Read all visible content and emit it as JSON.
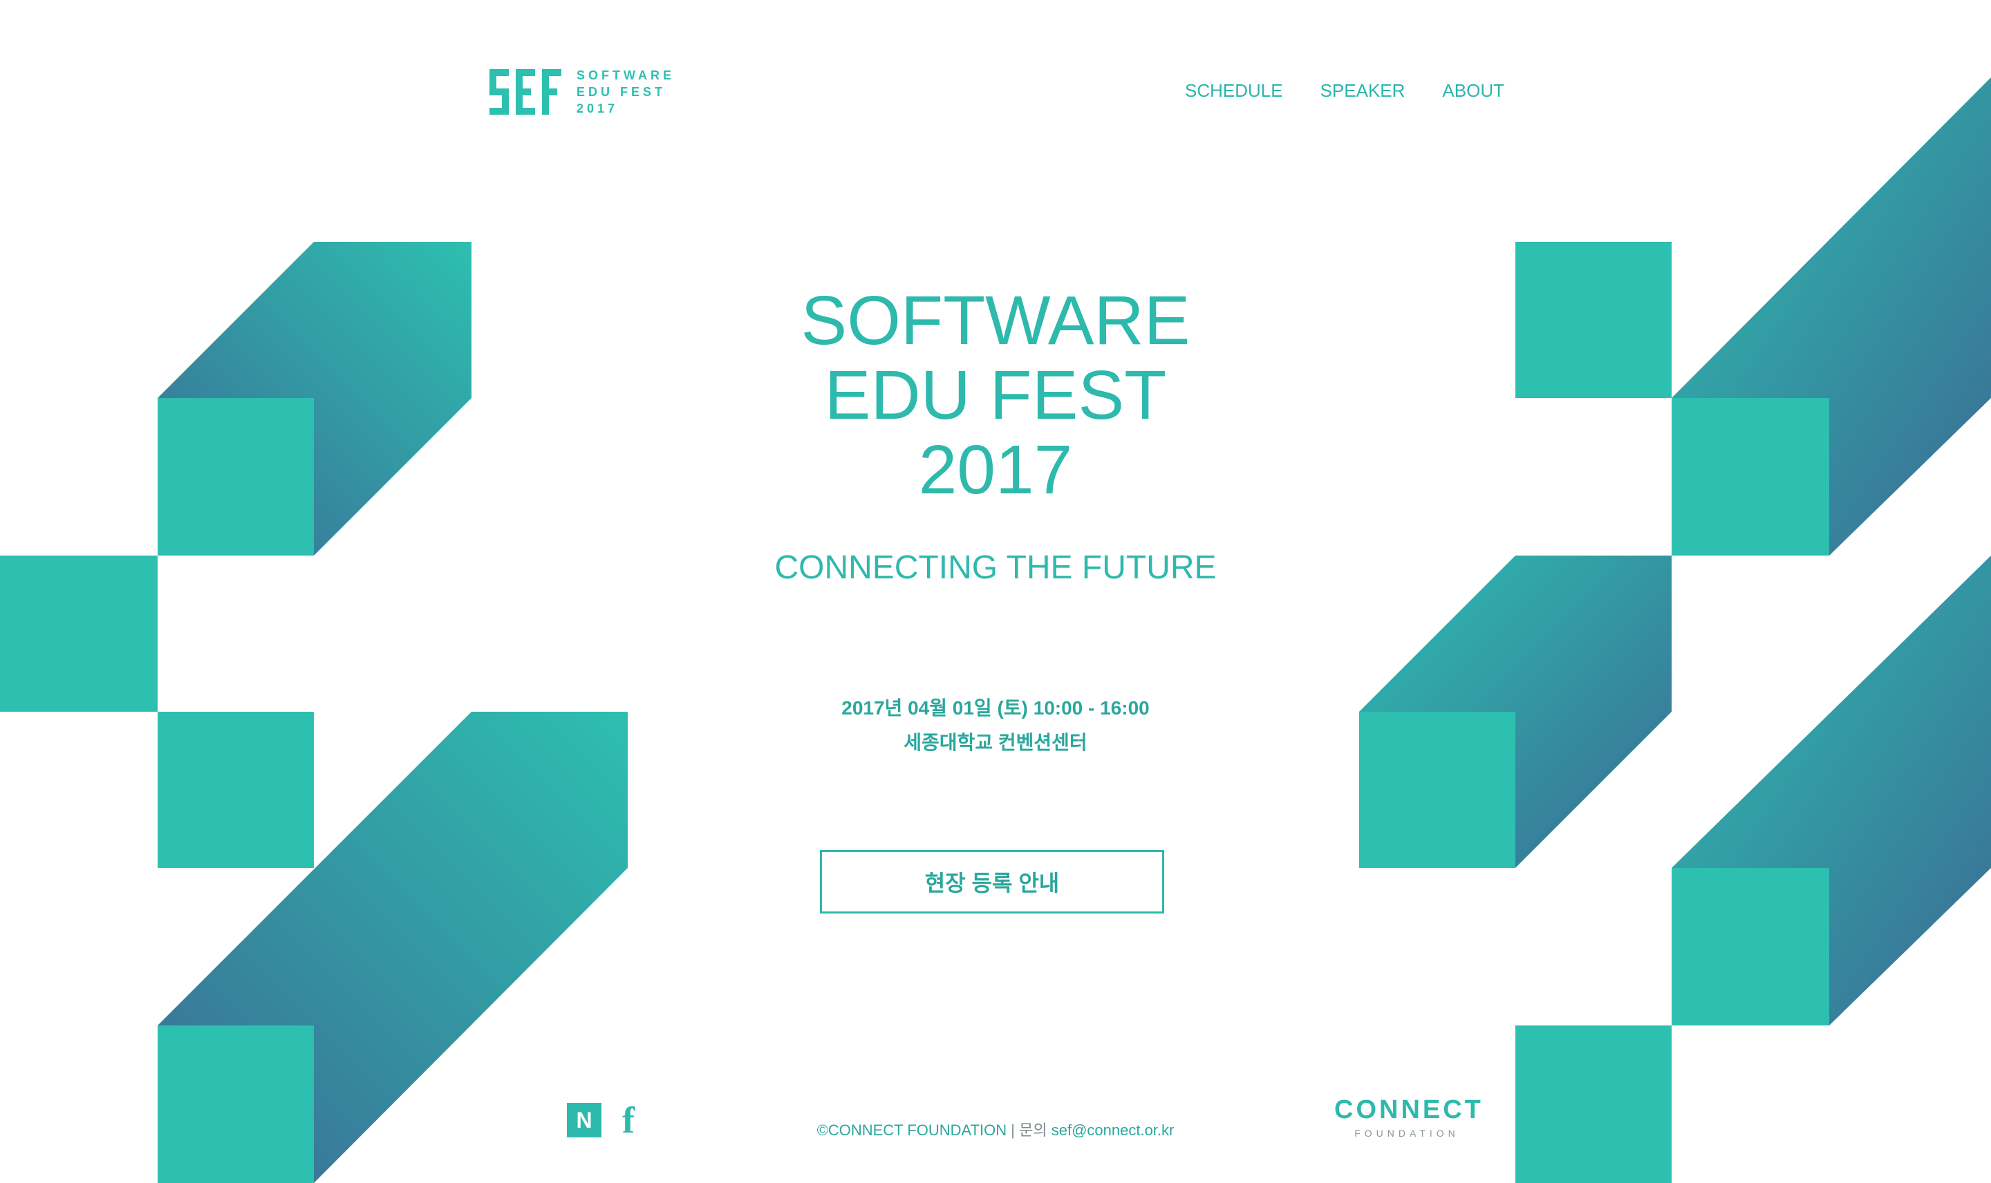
{
  "colors": {
    "teal": "#2dbfb0",
    "text_teal": "#2aa79d",
    "dark_blue": "#3b6b94"
  },
  "header": {
    "logo_mark": "SEF",
    "logo_lines": [
      "SOFTWARE",
      "EDU FEST",
      "2017"
    ],
    "nav": [
      "SCHEDULE",
      "SPEAKER",
      "ABOUT"
    ]
  },
  "hero": {
    "title_lines": [
      "SOFTWARE",
      "EDU FEST",
      "2017"
    ],
    "tagline": "CONNECTING THE FUTURE",
    "date": "2017년 04월 01일 (토) 10:00 - 16:00",
    "venue": "세종대학교 컨벤션센터",
    "register_button": "현장 등록 안내"
  },
  "footer": {
    "social_icons": [
      "naver-icon",
      "facebook-icon"
    ],
    "naver_glyph": "N",
    "facebook_glyph": "f",
    "copyright": "©CONNECT FOUNDATION",
    "separator": "|",
    "contact_label": "문의",
    "email": "sef@connect.or.kr",
    "partner_logo": {
      "word": "CONNECT",
      "sub": "FOUNDATION"
    }
  }
}
